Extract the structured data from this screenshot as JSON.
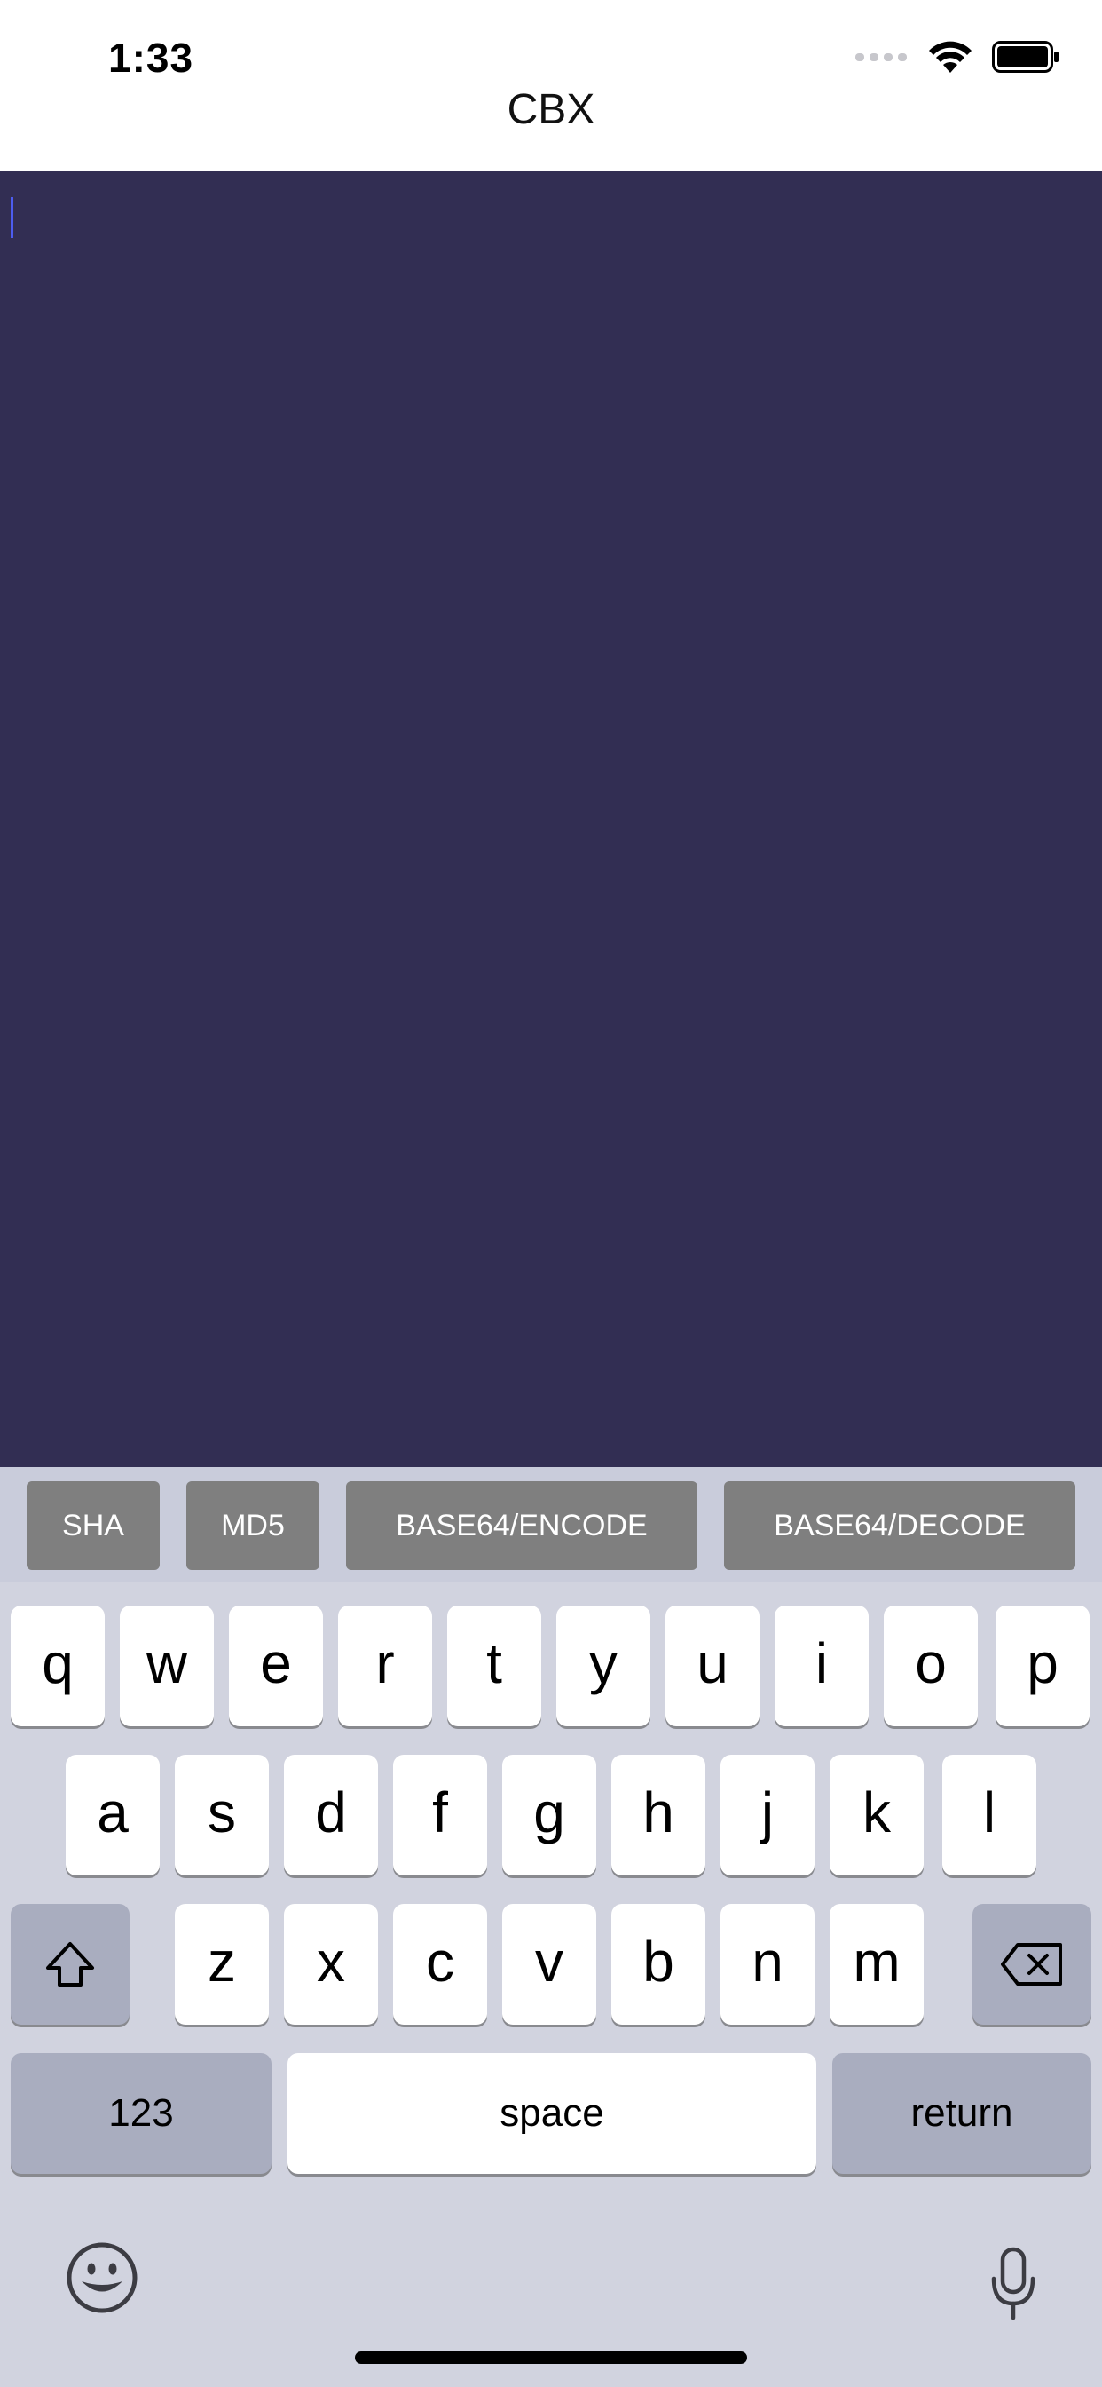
{
  "status": {
    "time": "1:33"
  },
  "nav": {
    "title": "CBX"
  },
  "accessory": {
    "buttons": [
      {
        "label": "SHA"
      },
      {
        "label": "MD5"
      },
      {
        "label": "BASE64/ENCODE"
      },
      {
        "label": "BASE64/DECODE"
      }
    ]
  },
  "keyboard": {
    "row1": [
      "q",
      "w",
      "e",
      "r",
      "t",
      "y",
      "u",
      "i",
      "o",
      "p"
    ],
    "row2": [
      "a",
      "s",
      "d",
      "f",
      "g",
      "h",
      "j",
      "k",
      "l"
    ],
    "row3": [
      "z",
      "x",
      "c",
      "v",
      "b",
      "n",
      "m"
    ],
    "numbers_label": "123",
    "space_label": "space",
    "return_label": "return"
  },
  "colors": {
    "editor_bg": "#322e53",
    "caret": "#4d5df0",
    "accessory_button": "#7f7f7f",
    "keyboard_bg": "#d1d3df"
  },
  "icons": [
    "wifi-icon",
    "battery-icon",
    "cellular-signal-icon",
    "shift-icon",
    "delete-icon",
    "emoji-icon",
    "microphone-icon"
  ]
}
